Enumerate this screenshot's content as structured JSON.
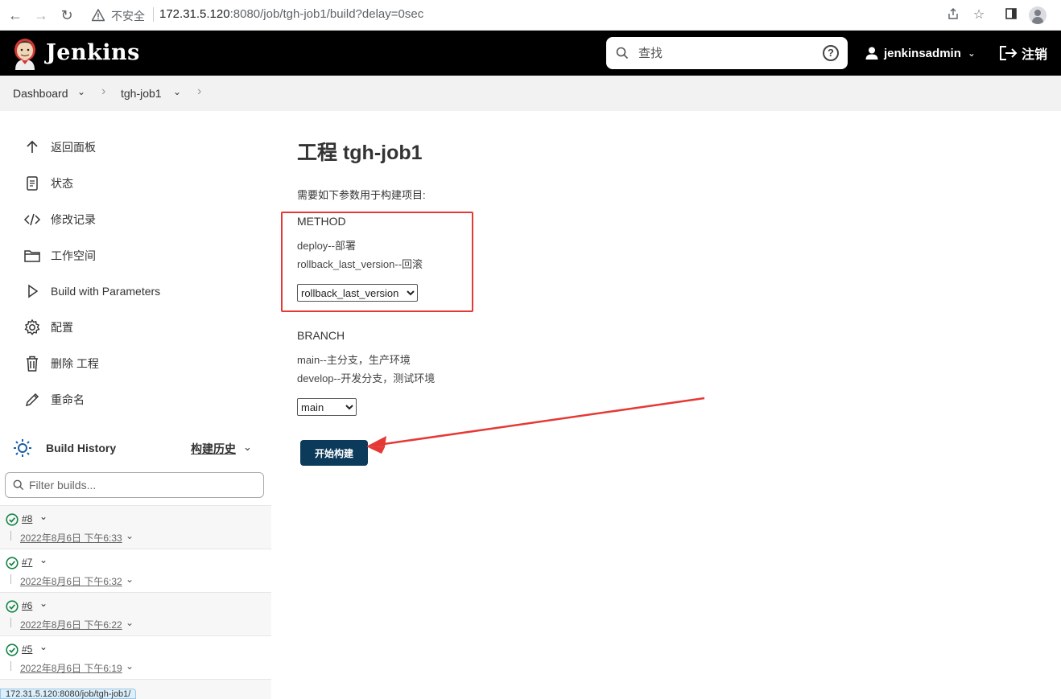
{
  "browser": {
    "insecure_label": "不安全",
    "url_host": "172.31.5.120",
    "url_rest": ":8080/job/tgh-job1/build?delay=0sec"
  },
  "header": {
    "app_name": "Jenkins",
    "search_placeholder": "查找",
    "help_label": "?",
    "username": "jenkinsadmin",
    "logout_label": "注销"
  },
  "breadcrumb": {
    "items": [
      "Dashboard",
      "tgh-job1"
    ]
  },
  "sidebar": {
    "tasks": [
      {
        "label": "返回面板",
        "icon": "arrow-up-icon"
      },
      {
        "label": "状态",
        "icon": "document-icon"
      },
      {
        "label": "修改记录",
        "icon": "code-icon"
      },
      {
        "label": "工作空间",
        "icon": "folder-icon"
      },
      {
        "label": "Build with Parameters",
        "icon": "play-icon"
      },
      {
        "label": "配置",
        "icon": "gear-icon"
      },
      {
        "label": "删除 工程",
        "icon": "trash-icon"
      },
      {
        "label": "重命名",
        "icon": "pencil-icon"
      }
    ],
    "build_history": {
      "title": "Build History",
      "trend_label": "构建历史",
      "filter_placeholder": "Filter builds...",
      "builds": [
        {
          "number": "#8",
          "date": "2022年8月6日 下午6:33",
          "status": "success"
        },
        {
          "number": "#7",
          "date": "2022年8月6日 下午6:32",
          "status": "success"
        },
        {
          "number": "#6",
          "date": "2022年8月6日 下午6:22",
          "status": "success"
        },
        {
          "number": "#5",
          "date": "2022年8月6日 下午6:19",
          "status": "success"
        }
      ]
    },
    "status_url": "172.31.5.120:8080/job/tgh-job1/"
  },
  "main": {
    "title": "工程 tgh-job1",
    "description": "需要如下参数用于构建项目:",
    "params": [
      {
        "name": "METHOD",
        "desc_lines": [
          "deploy--部署",
          "rollback_last_version--回滚"
        ],
        "selected": "rollback_last_version",
        "options": [
          "deploy",
          "rollback_last_version"
        ]
      },
      {
        "name": "BRANCH",
        "desc_lines": [
          "main--主分支，生产环境",
          "develop--开发分支，测试环境"
        ],
        "selected": "main",
        "options": [
          "main",
          "develop"
        ]
      }
    ],
    "build_button": "开始构建"
  },
  "colors": {
    "header_bg": "#000000",
    "build_button_bg": "#0b3a5a",
    "annotation_red": "#e53935",
    "success_green": "#138347"
  }
}
